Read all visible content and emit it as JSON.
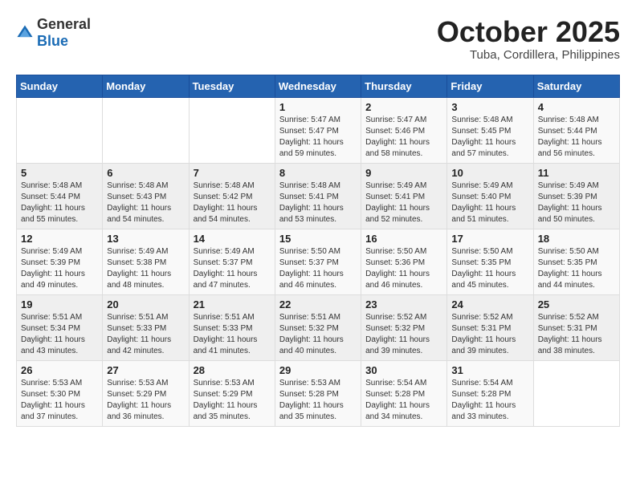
{
  "header": {
    "logo_general": "General",
    "logo_blue": "Blue",
    "month_title": "October 2025",
    "location": "Tuba, Cordillera, Philippines"
  },
  "days_of_week": [
    "Sunday",
    "Monday",
    "Tuesday",
    "Wednesday",
    "Thursday",
    "Friday",
    "Saturday"
  ],
  "weeks": [
    [
      {
        "day": "",
        "info": ""
      },
      {
        "day": "",
        "info": ""
      },
      {
        "day": "",
        "info": ""
      },
      {
        "day": "1",
        "info": "Sunrise: 5:47 AM\nSunset: 5:47 PM\nDaylight: 11 hours\nand 59 minutes."
      },
      {
        "day": "2",
        "info": "Sunrise: 5:47 AM\nSunset: 5:46 PM\nDaylight: 11 hours\nand 58 minutes."
      },
      {
        "day": "3",
        "info": "Sunrise: 5:48 AM\nSunset: 5:45 PM\nDaylight: 11 hours\nand 57 minutes."
      },
      {
        "day": "4",
        "info": "Sunrise: 5:48 AM\nSunset: 5:44 PM\nDaylight: 11 hours\nand 56 minutes."
      }
    ],
    [
      {
        "day": "5",
        "info": "Sunrise: 5:48 AM\nSunset: 5:44 PM\nDaylight: 11 hours\nand 55 minutes."
      },
      {
        "day": "6",
        "info": "Sunrise: 5:48 AM\nSunset: 5:43 PM\nDaylight: 11 hours\nand 54 minutes."
      },
      {
        "day": "7",
        "info": "Sunrise: 5:48 AM\nSunset: 5:42 PM\nDaylight: 11 hours\nand 54 minutes."
      },
      {
        "day": "8",
        "info": "Sunrise: 5:48 AM\nSunset: 5:41 PM\nDaylight: 11 hours\nand 53 minutes."
      },
      {
        "day": "9",
        "info": "Sunrise: 5:49 AM\nSunset: 5:41 PM\nDaylight: 11 hours\nand 52 minutes."
      },
      {
        "day": "10",
        "info": "Sunrise: 5:49 AM\nSunset: 5:40 PM\nDaylight: 11 hours\nand 51 minutes."
      },
      {
        "day": "11",
        "info": "Sunrise: 5:49 AM\nSunset: 5:39 PM\nDaylight: 11 hours\nand 50 minutes."
      }
    ],
    [
      {
        "day": "12",
        "info": "Sunrise: 5:49 AM\nSunset: 5:39 PM\nDaylight: 11 hours\nand 49 minutes."
      },
      {
        "day": "13",
        "info": "Sunrise: 5:49 AM\nSunset: 5:38 PM\nDaylight: 11 hours\nand 48 minutes."
      },
      {
        "day": "14",
        "info": "Sunrise: 5:49 AM\nSunset: 5:37 PM\nDaylight: 11 hours\nand 47 minutes."
      },
      {
        "day": "15",
        "info": "Sunrise: 5:50 AM\nSunset: 5:37 PM\nDaylight: 11 hours\nand 46 minutes."
      },
      {
        "day": "16",
        "info": "Sunrise: 5:50 AM\nSunset: 5:36 PM\nDaylight: 11 hours\nand 46 minutes."
      },
      {
        "day": "17",
        "info": "Sunrise: 5:50 AM\nSunset: 5:35 PM\nDaylight: 11 hours\nand 45 minutes."
      },
      {
        "day": "18",
        "info": "Sunrise: 5:50 AM\nSunset: 5:35 PM\nDaylight: 11 hours\nand 44 minutes."
      }
    ],
    [
      {
        "day": "19",
        "info": "Sunrise: 5:51 AM\nSunset: 5:34 PM\nDaylight: 11 hours\nand 43 minutes."
      },
      {
        "day": "20",
        "info": "Sunrise: 5:51 AM\nSunset: 5:33 PM\nDaylight: 11 hours\nand 42 minutes."
      },
      {
        "day": "21",
        "info": "Sunrise: 5:51 AM\nSunset: 5:33 PM\nDaylight: 11 hours\nand 41 minutes."
      },
      {
        "day": "22",
        "info": "Sunrise: 5:51 AM\nSunset: 5:32 PM\nDaylight: 11 hours\nand 40 minutes."
      },
      {
        "day": "23",
        "info": "Sunrise: 5:52 AM\nSunset: 5:32 PM\nDaylight: 11 hours\nand 39 minutes."
      },
      {
        "day": "24",
        "info": "Sunrise: 5:52 AM\nSunset: 5:31 PM\nDaylight: 11 hours\nand 39 minutes."
      },
      {
        "day": "25",
        "info": "Sunrise: 5:52 AM\nSunset: 5:31 PM\nDaylight: 11 hours\nand 38 minutes."
      }
    ],
    [
      {
        "day": "26",
        "info": "Sunrise: 5:53 AM\nSunset: 5:30 PM\nDaylight: 11 hours\nand 37 minutes."
      },
      {
        "day": "27",
        "info": "Sunrise: 5:53 AM\nSunset: 5:29 PM\nDaylight: 11 hours\nand 36 minutes."
      },
      {
        "day": "28",
        "info": "Sunrise: 5:53 AM\nSunset: 5:29 PM\nDaylight: 11 hours\nand 35 minutes."
      },
      {
        "day": "29",
        "info": "Sunrise: 5:53 AM\nSunset: 5:28 PM\nDaylight: 11 hours\nand 35 minutes."
      },
      {
        "day": "30",
        "info": "Sunrise: 5:54 AM\nSunset: 5:28 PM\nDaylight: 11 hours\nand 34 minutes."
      },
      {
        "day": "31",
        "info": "Sunrise: 5:54 AM\nSunset: 5:28 PM\nDaylight: 11 hours\nand 33 minutes."
      },
      {
        "day": "",
        "info": ""
      }
    ]
  ]
}
